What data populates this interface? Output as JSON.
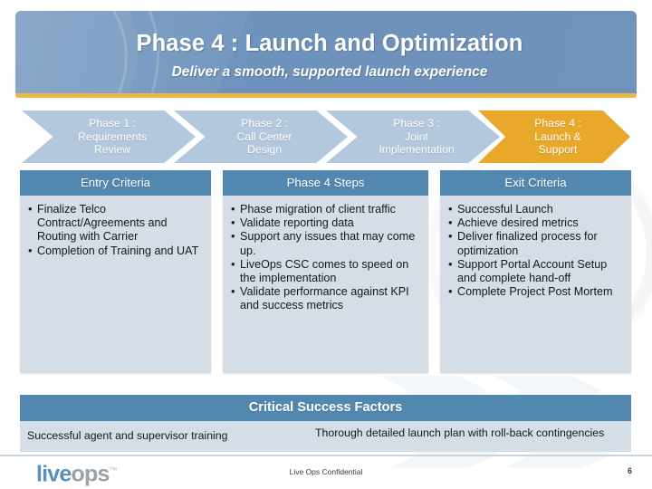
{
  "banner": {
    "title": "Phase 4 : Launch and Optimization",
    "subtitle": "Deliver a smooth, supported launch experience",
    "background_color": "#6f93bb",
    "rule_color": "#edb84a"
  },
  "phases": {
    "inactive_color": "#b3c8dd",
    "active_color": "#e8a82a",
    "items": [
      {
        "label": "Phase 1 :\nRequirements\nReview",
        "active": false
      },
      {
        "label": "Phase 2 :\nCall Center\nDesign",
        "active": false
      },
      {
        "label": "Phase 3 :\nJoint\nImplementation",
        "active": false
      },
      {
        "label": "Phase 4 :\nLaunch &\nSupport",
        "active": true
      }
    ]
  },
  "columns": {
    "header_color": "#5288b0",
    "body_color": "#d5dde6",
    "entry": {
      "header": "Entry Criteria",
      "items": [
        "Finalize Telco Contract/Agreements and Routing with Carrier",
        "Completion of Training and UAT"
      ]
    },
    "steps": {
      "header": "Phase 4 Steps",
      "items": [
        "Phase migration of client traffic",
        "Validate reporting data",
        "Support any issues that may come up.",
        "LiveOps CSC comes to speed on the implementation",
        "Validate performance against KPI and success metrics"
      ]
    },
    "exit": {
      "header": "Exit Criteria",
      "items": [
        "Successful Launch",
        "Achieve desired metrics",
        "Deliver finalized process for optimization",
        "Support Portal Account Setup and complete hand-off",
        "Complete Project Post Mortem"
      ]
    }
  },
  "critical_success_factors": {
    "header": "Critical Success Factors",
    "cells": [
      "Successful agent and supervisor training",
      "Thorough detailed launch plan with roll-back contingencies"
    ]
  },
  "footer": {
    "logo_primary": "live",
    "logo_secondary": "ops",
    "logo_tm": "™",
    "confidential": "Live Ops Confidential",
    "page_number": "6"
  }
}
